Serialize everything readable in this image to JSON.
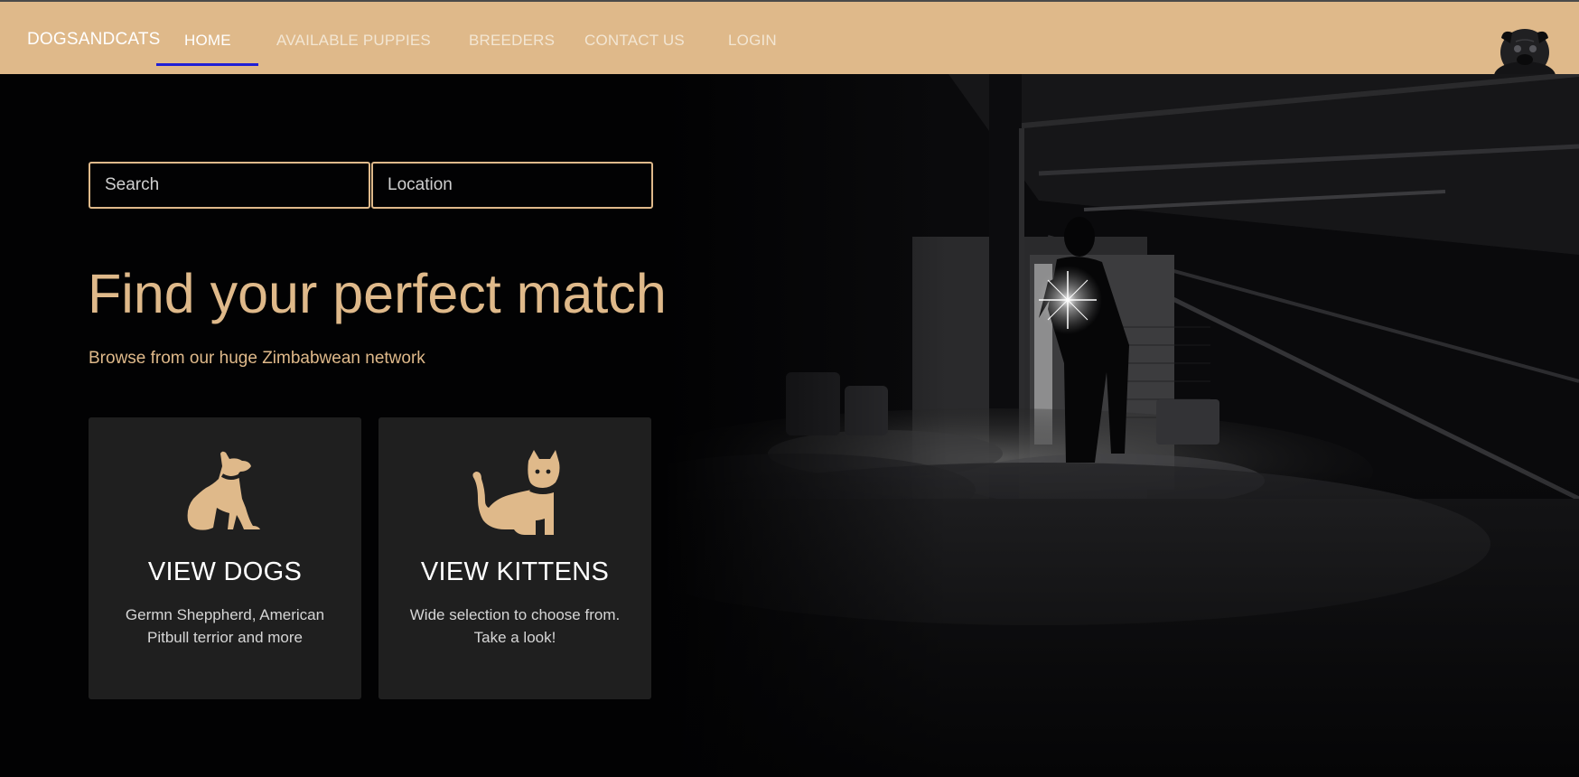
{
  "nav": {
    "brand": "DOGSANDCATS",
    "links": [
      {
        "label": "HOME",
        "active": true
      },
      {
        "label": "AVAILABLE PUPPIES",
        "active": false
      },
      {
        "label": "BREEDERS",
        "active": false
      },
      {
        "label": "CONTACT US",
        "active": false
      },
      {
        "label": "LOGIN",
        "active": false
      }
    ],
    "avatar_icon": "pug-photo"
  },
  "search": {
    "search_placeholder": "Search",
    "location_placeholder": "Location"
  },
  "hero": {
    "headline": "Find your perfect match",
    "subheadline": "Browse from our huge Zimbabwean network",
    "background": "dark-attic-photo-with-flashlight-figure"
  },
  "cards": [
    {
      "icon": "dog-icon",
      "title": "VIEW DOGS",
      "description": "Germn Sheppherd, American Pitbull terrior and more"
    },
    {
      "icon": "cat-icon",
      "title": "VIEW KITTENS",
      "description": "Wide selection to choose from. Take a look!"
    }
  ],
  "colors": {
    "accent": "#dfb98a",
    "nav_background": "#dfb98a",
    "active_underline": "#1f1fd6",
    "page_background": "#020203",
    "card_background": "#1f1f1f"
  }
}
